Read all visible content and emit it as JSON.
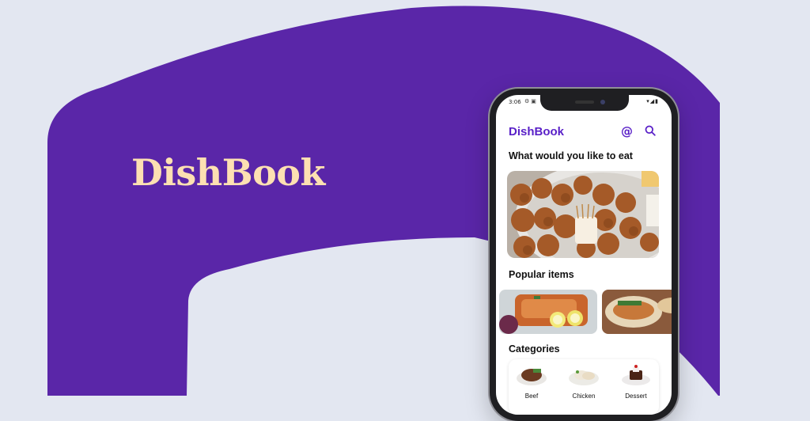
{
  "banner": {
    "brand_name": "DishBook",
    "colors": {
      "background": "#e3e7f1",
      "purple": "#5a26a8",
      "brand_text": "#fde0b2"
    }
  },
  "status_bar": {
    "time": "3:06",
    "left_icons": [
      "settings-icon",
      "message-icon"
    ],
    "right_icons": [
      "wifi-icon",
      "signal-icon",
      "battery-icon"
    ]
  },
  "app_header": {
    "title": "DishBook",
    "icons": [
      "at-sign-icon",
      "search-icon"
    ]
  },
  "hero": {
    "heading": "What would you like to eat"
  },
  "popular": {
    "heading": "Popular items"
  },
  "categories": {
    "heading": "Categories",
    "items": [
      {
        "label": "Beef"
      },
      {
        "label": "Chicken"
      },
      {
        "label": "Dessert"
      }
    ]
  }
}
